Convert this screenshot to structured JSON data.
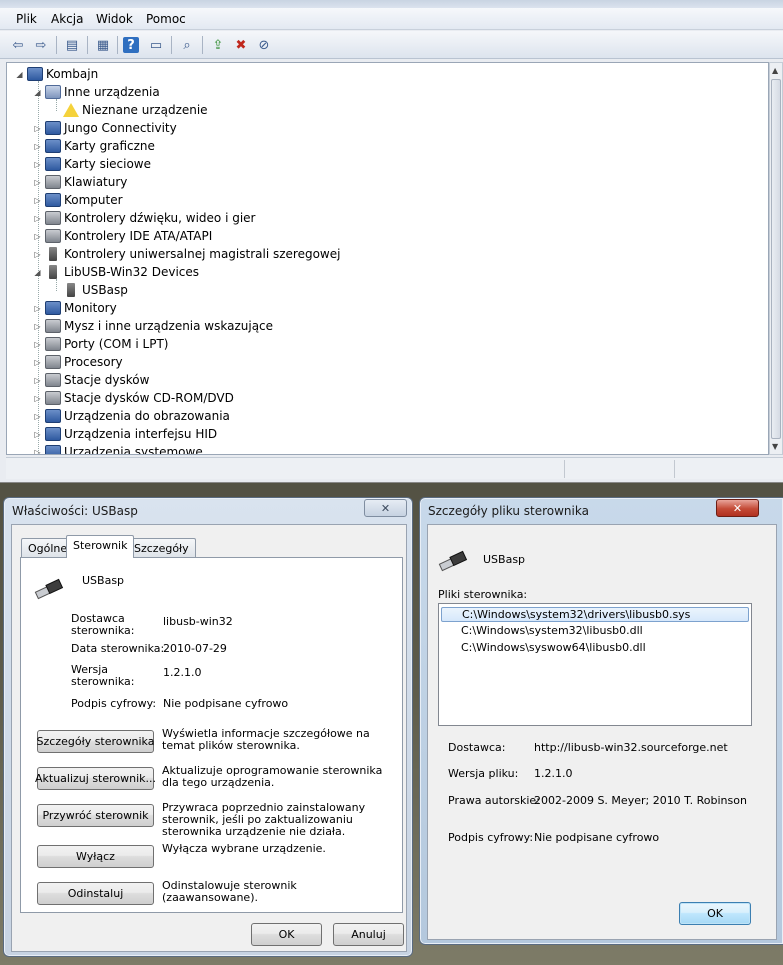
{
  "device_manager": {
    "menu": [
      "Plik",
      "Akcja",
      "Widok",
      "Pomoc"
    ],
    "toolbar_icons": [
      "back-icon",
      "forward-icon",
      "up-level-icon",
      "properties-icon",
      "help-icon",
      "show-hidden-icon",
      "scan-hardware-icon",
      "update-driver-icon",
      "uninstall-icon",
      "disable-icon"
    ],
    "tree": [
      {
        "label": "Kombajn",
        "level": 0,
        "expand": "expanded",
        "icon": "computer-icon"
      },
      {
        "label": "Inne urządzenia",
        "level": 1,
        "expand": "expanded",
        "icon": "unknown-device-icon"
      },
      {
        "label": "Nieznane urządzenie",
        "level": 2,
        "expand": "none",
        "icon": "warning-device-icon"
      },
      {
        "label": "Jungo Connectivity",
        "level": 1,
        "expand": "collapsed",
        "icon": "jungo-icon"
      },
      {
        "label": "Karty graficzne",
        "level": 1,
        "expand": "collapsed",
        "icon": "display-adapter-icon"
      },
      {
        "label": "Karty sieciowe",
        "level": 1,
        "expand": "collapsed",
        "icon": "network-adapter-icon"
      },
      {
        "label": "Klawiatury",
        "level": 1,
        "expand": "collapsed",
        "icon": "keyboard-icon"
      },
      {
        "label": "Komputer",
        "level": 1,
        "expand": "collapsed",
        "icon": "computer-icon"
      },
      {
        "label": "Kontrolery dźwięku, wideo i gier",
        "level": 1,
        "expand": "collapsed",
        "icon": "sound-icon"
      },
      {
        "label": "Kontrolery IDE ATA/ATAPI",
        "level": 1,
        "expand": "collapsed",
        "icon": "ide-controller-icon"
      },
      {
        "label": "Kontrolery uniwersalnej magistrali szeregowej",
        "level": 1,
        "expand": "collapsed",
        "icon": "usb-controller-icon"
      },
      {
        "label": "LibUSB-Win32 Devices",
        "level": 1,
        "expand": "expanded",
        "icon": "usb-device-icon"
      },
      {
        "label": "USBasp",
        "level": 2,
        "expand": "none",
        "icon": "usb-device-icon"
      },
      {
        "label": "Monitory",
        "level": 1,
        "expand": "collapsed",
        "icon": "monitor-icon"
      },
      {
        "label": "Mysz i inne urządzenia wskazujące",
        "level": 1,
        "expand": "collapsed",
        "icon": "mouse-icon"
      },
      {
        "label": "Porty (COM i LPT)",
        "level": 1,
        "expand": "collapsed",
        "icon": "port-icon"
      },
      {
        "label": "Procesory",
        "level": 1,
        "expand": "collapsed",
        "icon": "processor-icon"
      },
      {
        "label": "Stacje dysków",
        "level": 1,
        "expand": "collapsed",
        "icon": "disk-drive-icon"
      },
      {
        "label": "Stacje dysków CD-ROM/DVD",
        "level": 1,
        "expand": "collapsed",
        "icon": "cdrom-icon"
      },
      {
        "label": "Urządzenia do obrazowania",
        "level": 1,
        "expand": "collapsed",
        "icon": "imaging-icon"
      },
      {
        "label": "Urządzenia interfejsu HID",
        "level": 1,
        "expand": "collapsed",
        "icon": "hid-icon"
      },
      {
        "label": "Urządzenia systemowe",
        "level": 1,
        "expand": "collapsed",
        "icon": "system-device-icon"
      }
    ]
  },
  "properties_dialog": {
    "title": "Właściwości: USBasp",
    "close_glyph": "✕",
    "tabs": [
      "Ogólne",
      "Sterownik",
      "Szczegóły"
    ],
    "active_tab": "Sterownik",
    "device_name": "USBasp",
    "fields": {
      "provider_label": "Dostawca sterownika:",
      "provider_value": "libusb-win32",
      "date_label": "Data sterownika:",
      "date_value": "2010-07-29",
      "version_label": "Wersja sterownika:",
      "version_value": "1.2.1.0",
      "signer_label": "Podpis cyfrowy:",
      "signer_value": "Nie podpisane cyfrowo"
    },
    "actions": [
      {
        "button": "Szczegóły sterownika",
        "desc": "Wyświetla informacje szczegółowe na temat plików sterownika."
      },
      {
        "button": "Aktualizuj sterownik...",
        "desc": "Aktualizuje oprogramowanie sterownika dla tego urządzenia."
      },
      {
        "button": "Przywróć sterownik",
        "desc": "Przywraca poprzednio zainstalowany sterownik, jeśli po zaktualizowaniu sterownika urządzenie nie działa."
      },
      {
        "button": "Wyłącz",
        "desc": "Wyłącza wybrane urządzenie."
      },
      {
        "button": "Odinstaluj",
        "desc": "Odinstalowuje sterownik (zaawansowane)."
      }
    ],
    "ok_label": "OK",
    "cancel_label": "Anuluj"
  },
  "driver_files_dialog": {
    "title": "Szczegóły pliku sterownika",
    "close_glyph": "✕",
    "device_name": "USBasp",
    "files_label": "Pliki sterownika:",
    "files": [
      "C:\\Windows\\system32\\drivers\\libusb0.sys",
      "C:\\Windows\\system32\\libusb0.dll",
      "C:\\Windows\\syswow64\\libusb0.dll"
    ],
    "selected_file_index": 0,
    "provider_label": "Dostawca:",
    "provider_value": "http://libusb-win32.sourceforge.net",
    "file_version_label": "Wersja pliku:",
    "file_version_value": "1.2.1.0",
    "copyright_label": "Prawa autorskie:",
    "copyright_value": "2002-2009 S. Meyer; 2010 T. Robinson",
    "signer_label": "Podpis cyfrowy:",
    "signer_value": "Nie podpisane cyfrowo",
    "ok_label": "OK"
  }
}
